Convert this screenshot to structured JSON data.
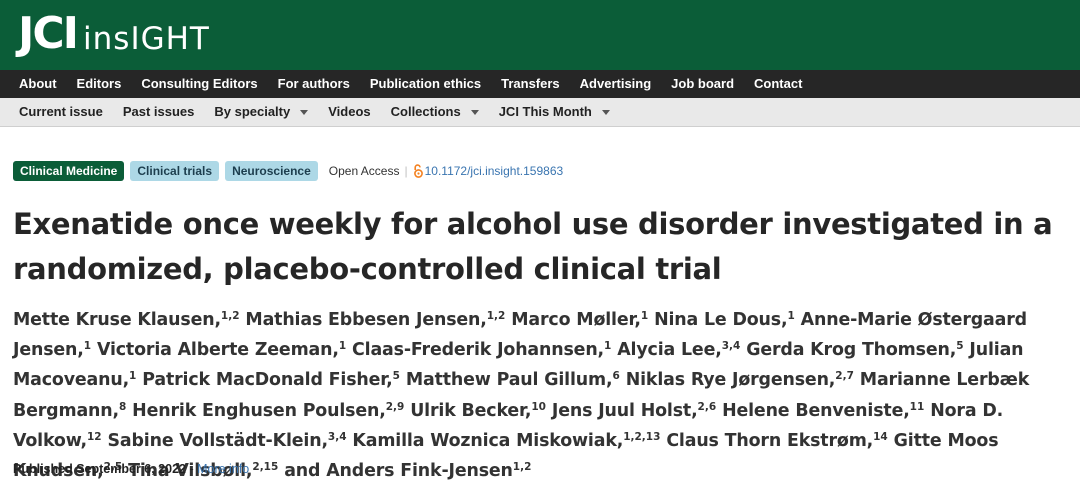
{
  "header": {
    "logo_main": "JCI",
    "logo_sub": "insIGHT"
  },
  "nav_primary": [
    "About",
    "Editors",
    "Consulting Editors",
    "For authors",
    "Publication ethics",
    "Transfers",
    "Advertising",
    "Job board",
    "Contact"
  ],
  "nav_secondary": [
    {
      "label": "Current issue",
      "dropdown": false
    },
    {
      "label": "Past issues",
      "dropdown": false
    },
    {
      "label": "By specialty",
      "dropdown": true
    },
    {
      "label": "Videos",
      "dropdown": false
    },
    {
      "label": "Collections",
      "dropdown": true
    },
    {
      "label": "JCI This Month",
      "dropdown": true
    }
  ],
  "article": {
    "tags": [
      "Clinical Medicine",
      "Clinical trials",
      "Neuroscience"
    ],
    "open_access_label": "Open Access",
    "separator": "|",
    "doi": "10.1172/jci.insight.159863",
    "title": "Exenatide once weekly for alcohol use disorder investigated in a randomized, placebo-controlled clinical trial",
    "authors": [
      {
        "name": "Mette Kruse Klausen,",
        "aff": "1,2"
      },
      {
        "name": "Mathias Ebbesen Jensen,",
        "aff": "1,2"
      },
      {
        "name": "Marco Møller,",
        "aff": "1"
      },
      {
        "name": "Nina Le Dous,",
        "aff": "1"
      },
      {
        "name": "Anne-Marie Østergaard Jensen,",
        "aff": "1"
      },
      {
        "name": "Victoria Alberte Zeeman,",
        "aff": "1"
      },
      {
        "name": "Claas-Frederik Johannsen,",
        "aff": "1"
      },
      {
        "name": "Alycia Lee,",
        "aff": "3,4"
      },
      {
        "name": "Gerda Krog Thomsen,",
        "aff": "5"
      },
      {
        "name": "Julian Macoveanu,",
        "aff": "1"
      },
      {
        "name": "Patrick MacDonald Fisher,",
        "aff": "5"
      },
      {
        "name": "Matthew Paul Gillum,",
        "aff": "6"
      },
      {
        "name": "Niklas Rye Jørgensen,",
        "aff": "2,7"
      },
      {
        "name": "Marianne Lerbæk Bergmann,",
        "aff": "8"
      },
      {
        "name": "Henrik Enghusen Poulsen,",
        "aff": "2,9"
      },
      {
        "name": "Ulrik Becker,",
        "aff": "10"
      },
      {
        "name": "Jens Juul Holst,",
        "aff": "2,6"
      },
      {
        "name": "Helene Benveniste,",
        "aff": "11"
      },
      {
        "name": "Nora D. Volkow,",
        "aff": "12"
      },
      {
        "name": "Sabine Vollstädt-Klein,",
        "aff": "3,4"
      },
      {
        "name": "Kamilla Woznica Miskowiak,",
        "aff": "1,2,13"
      },
      {
        "name": "Claus Thorn Ekstrøm,",
        "aff": "14"
      },
      {
        "name": "Gitte Moos Knudsen,",
        "aff": "2,5"
      },
      {
        "name": "Tina Vilsbøll,",
        "aff": "2,15"
      },
      {
        "name": "and Anders Fink-Jensen",
        "aff": "1,2"
      }
    ],
    "published_label": "Published September 6, 2022",
    "published_sep": " - ",
    "more_info": "More info"
  },
  "colors": {
    "brand_green": "#0b5d38",
    "nav_dark": "#262626",
    "nav_light": "#e9e9e9",
    "tag_blue": "#add8e6",
    "link_blue": "#3a75b0",
    "open_access_orange": "#f48120"
  },
  "icons": [
    "open-access-lock-icon",
    "chevron-down-icon"
  ]
}
